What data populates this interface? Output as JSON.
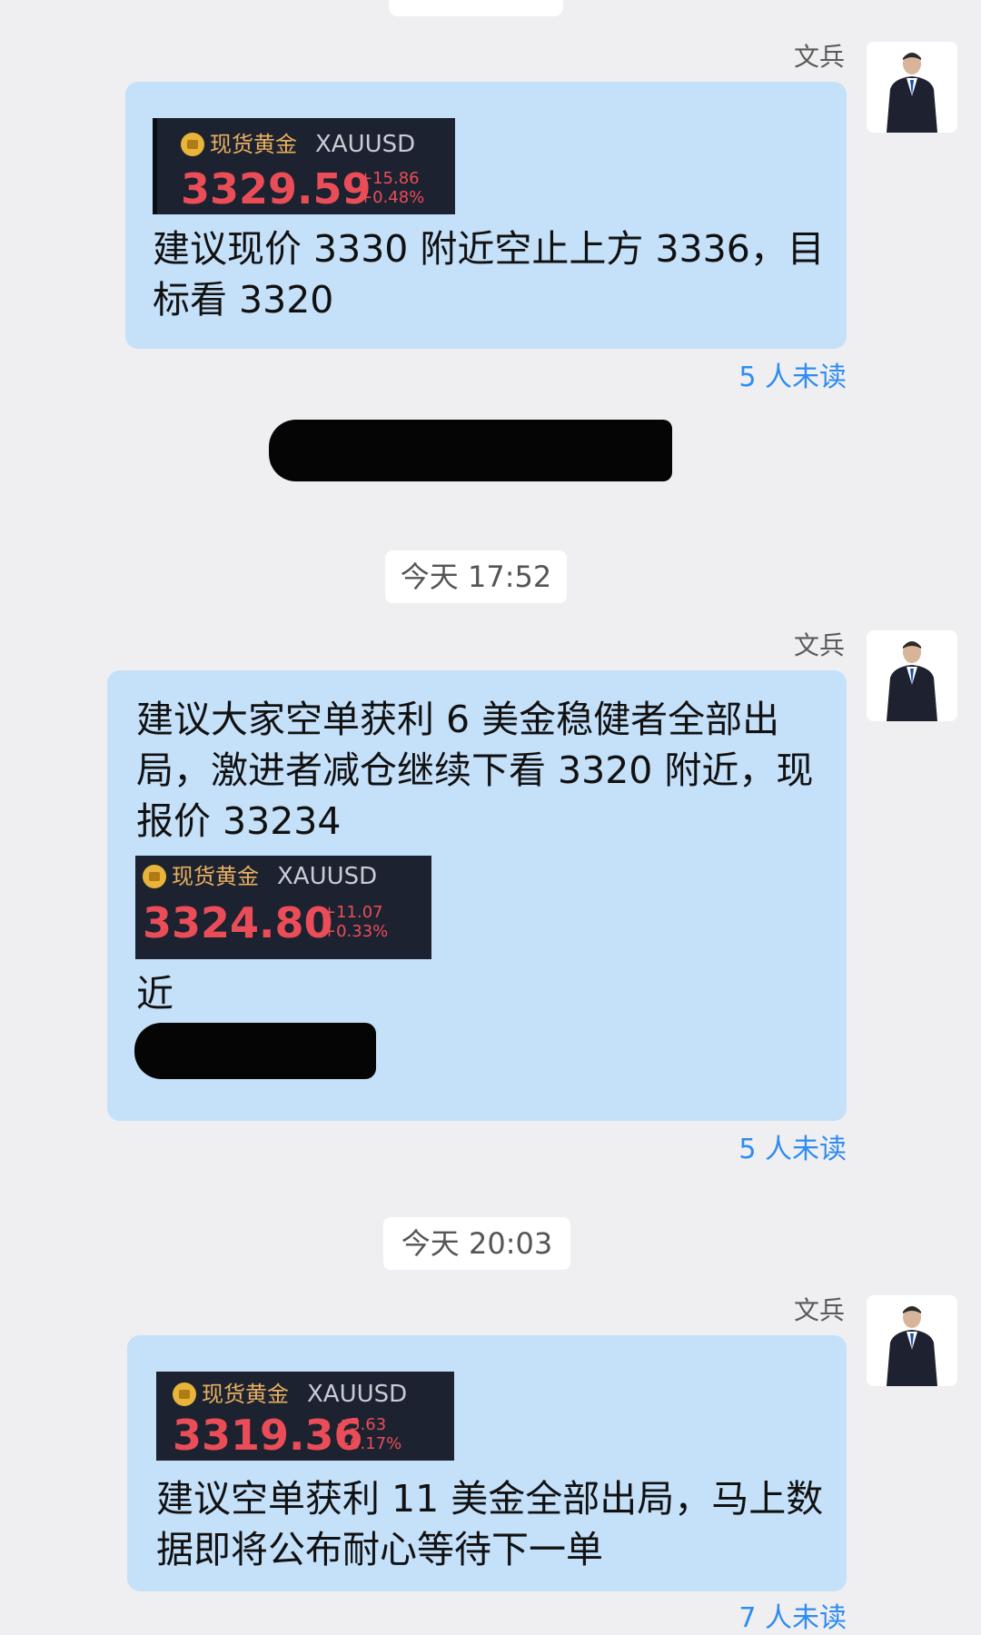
{
  "messages": [
    {
      "sender": "文兵",
      "ticker": {
        "name": "现货黄金",
        "symbol": "XAUUSD",
        "price": "3329.59",
        "change": "+15.86",
        "change_pct": "+0.48%"
      },
      "text": "建议现价 3330 附近空止上方 3336，目标看 3320",
      "unread": "5 人未读"
    },
    {
      "timestamp": "今天 17:52",
      "sender": "文兵",
      "text": "建议大家空单获利 6 美金稳健者全部出局，激进者减仓继续下看 3320 附近，现报价 33234",
      "ticker": {
        "name": "现货黄金",
        "symbol": "XAUUSD",
        "price": "3324.80",
        "change": "+11.07",
        "change_pct": "+0.33%"
      },
      "text_after": "近",
      "unread": "5 人未读"
    },
    {
      "timestamp": "今天 20:03",
      "sender": "文兵",
      "ticker": {
        "name": "现货黄金",
        "symbol": "XAUUSD",
        "price": "3319.36",
        "change": "+5.63",
        "change_pct": "+0.17%"
      },
      "text": "建议空单获利 11 美金全部出局，马上数据即将公布耐心等待下一单",
      "unread": "7 人未读"
    }
  ]
}
